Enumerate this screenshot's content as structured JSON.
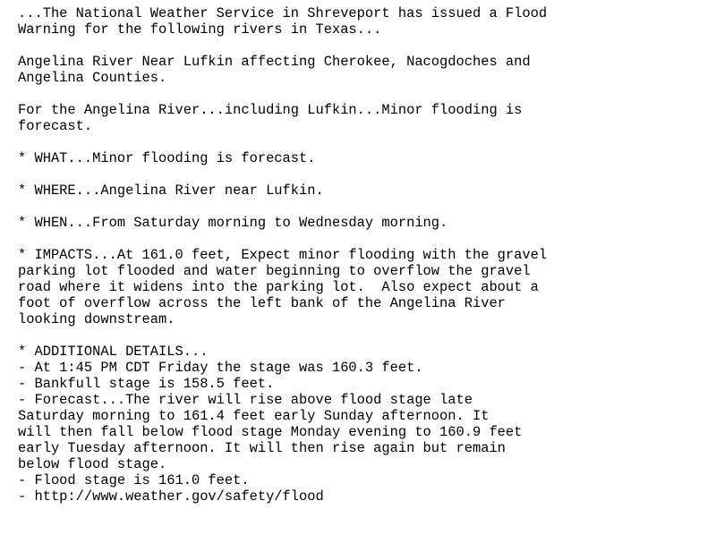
{
  "bulletin": {
    "headline": [
      "...The National Weather Service in Shreveport has issued a Flood",
      "Warning for the following rivers in Texas..."
    ],
    "river_location": [
      "Angelina River Near Lufkin affecting Cherokee, Nacogdoches and",
      "Angelina Counties."
    ],
    "forecast_summary": [
      "For the Angelina River...including Lufkin...Minor flooding is",
      "forecast."
    ],
    "what": "* WHAT...Minor flooding is forecast.",
    "where": "* WHERE...Angelina River near Lufkin.",
    "when": "* WHEN...From Saturday morning to Wednesday morning.",
    "impacts": [
      "* IMPACTS...At 161.0 feet, Expect minor flooding with the gravel",
      "parking lot flooded and water beginning to overflow the gravel",
      "road where it widens into the parking lot.  Also expect about a",
      "foot of overflow across the left bank of the Angelina River",
      "looking downstream."
    ],
    "additional_details": {
      "heading": "* ADDITIONAL DETAILS...",
      "lines": [
        "- At 1:45 PM CDT Friday the stage was 160.3 feet.",
        "- Bankfull stage is 158.5 feet.",
        "- Forecast...The river will rise above flood stage late",
        "Saturday morning to 161.4 feet early Sunday afternoon. It",
        "will then fall below flood stage Monday evening to 160.9 feet",
        "early Tuesday afternoon. It will then rise again but remain",
        "below flood stage.",
        "- Flood stage is 161.0 feet.",
        "- http://www.weather.gov/safety/flood"
      ]
    }
  }
}
